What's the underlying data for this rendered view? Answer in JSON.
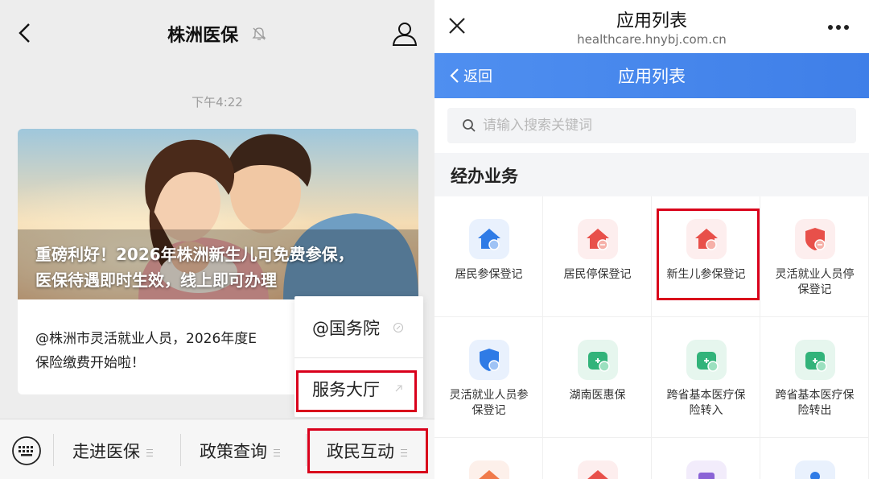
{
  "left": {
    "title": "株洲医保",
    "time": "下午4:22",
    "card": {
      "headline_line1": "重磅利好！2026年株洲新生儿可免费参保，",
      "headline_line2": "医保待遇即时生效，线上即可办理",
      "desc_line1": "@株洲市灵活就业人员，2026年度E",
      "desc_line2": "保险缴费开始啦！"
    },
    "popup": {
      "items": [
        {
          "label": "@国务院"
        },
        {
          "label": "服务大厅"
        }
      ]
    },
    "tabbar": {
      "tabs": [
        {
          "label": "走进医保"
        },
        {
          "label": "政策查询"
        },
        {
          "label": "政民互动"
        }
      ]
    }
  },
  "right": {
    "page_title": "应用列表",
    "url": "healthcare.hnybj.com.cn",
    "nav": {
      "back_label": "返回",
      "title": "应用列表"
    },
    "search": {
      "placeholder": "请输入搜索关键词"
    },
    "section": "经办业务",
    "apps": [
      {
        "line1": "居民参保登记",
        "line2": ""
      },
      {
        "line1": "居民停保登记",
        "line2": ""
      },
      {
        "line1": "新生儿参保登记",
        "line2": ""
      },
      {
        "line1": "灵活就业人员停",
        "line2": "保登记"
      },
      {
        "line1": "灵活就业人员参",
        "line2": "保登记"
      },
      {
        "line1": "湖南医惠保",
        "line2": ""
      },
      {
        "line1": "跨省基本医疗保",
        "line2": "险转入"
      },
      {
        "line1": "跨省基本医疗保",
        "line2": "险转出"
      }
    ]
  },
  "colors": {
    "highlight": "#d9001b",
    "nav_blue": "#4a8bee",
    "icon_blue": "#2f7be6",
    "icon_red": "#e8504a",
    "icon_green": "#32b37a"
  }
}
